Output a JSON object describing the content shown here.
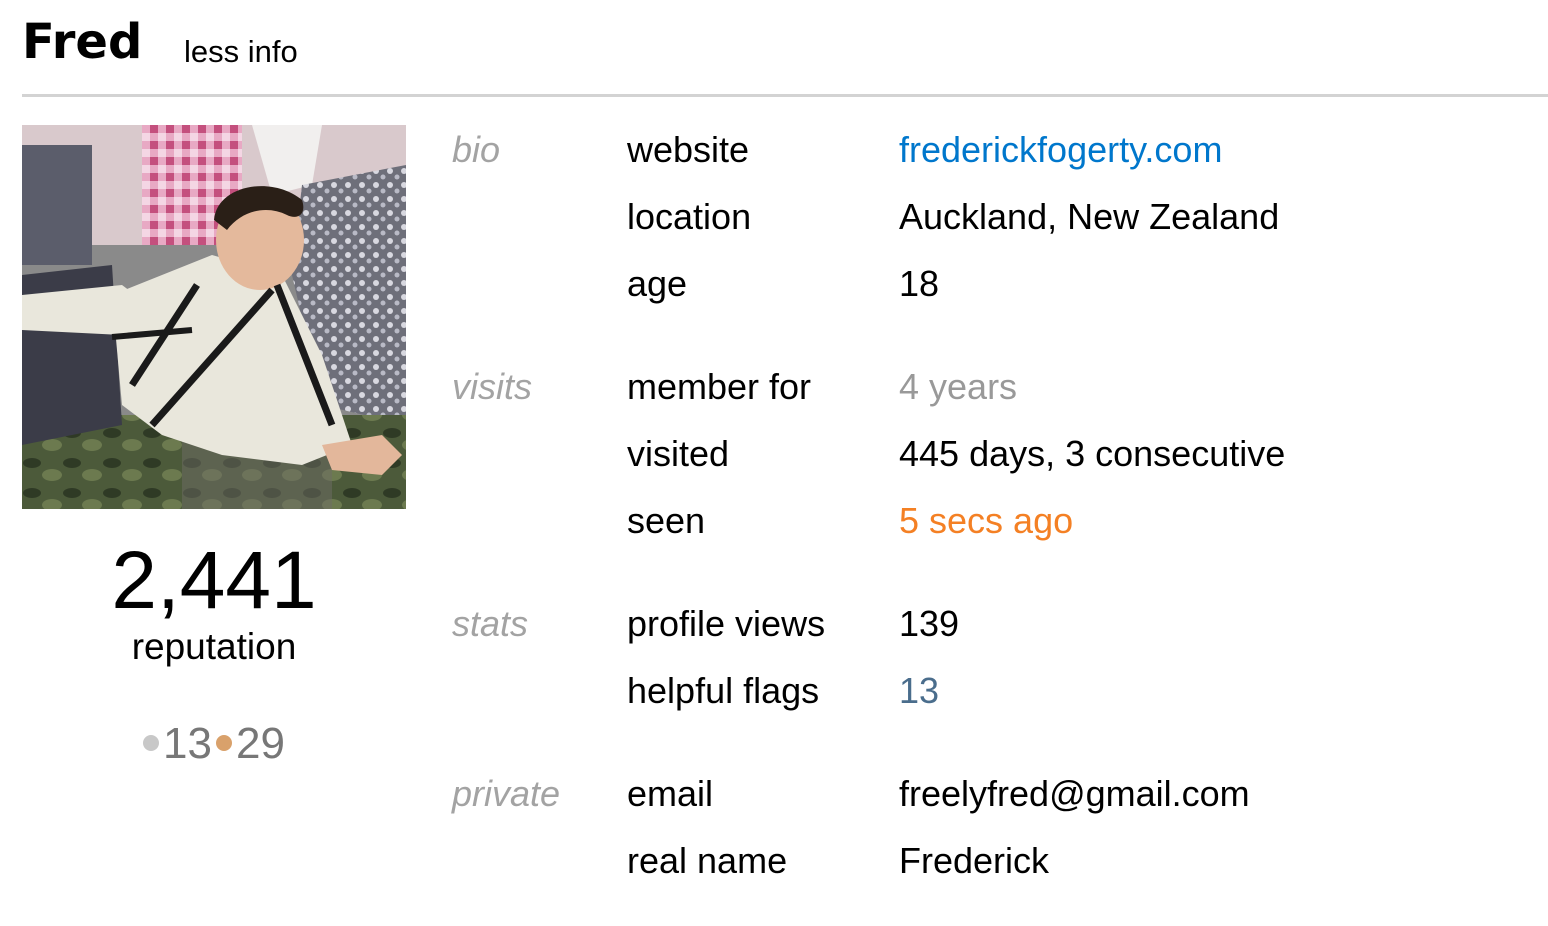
{
  "header": {
    "user_name": "Fred",
    "toggle_label": "less info"
  },
  "avatar": {
    "alt": "Fred"
  },
  "reputation": {
    "value": "2,441",
    "label": "reputation"
  },
  "badges": {
    "silver": {
      "count": "13",
      "color": "#c8c8c8"
    },
    "bronze": {
      "count": "29",
      "color": "#d9a16b"
    }
  },
  "groups": {
    "bio": {
      "label": "bio",
      "website_label": "website",
      "website_value": "frederickfogerty.com",
      "location_label": "location",
      "location_value": "Auckland, New Zealand",
      "age_label": "age",
      "age_value": "18"
    },
    "visits": {
      "label": "visits",
      "member_label": "member for",
      "member_value": "4 years",
      "visited_label": "visited",
      "visited_value": "445 days, 3 consecutive",
      "seen_label": "seen",
      "seen_value": "5 secs ago"
    },
    "stats": {
      "label": "stats",
      "views_label": "profile views",
      "views_value": "139",
      "flags_label": "helpful flags",
      "flags_value": "13"
    },
    "private": {
      "label": "private",
      "email_label": "email",
      "email_value": "freelyfred@gmail.com",
      "realname_label": "real name",
      "realname_value": "Frederick"
    }
  },
  "colors": {
    "link": "#0077cc",
    "muted": "#999999",
    "seen": "#f48024",
    "flags": "#4a6d8c",
    "group_label": "#a3a3a3",
    "divider": "#d3d3d3"
  }
}
